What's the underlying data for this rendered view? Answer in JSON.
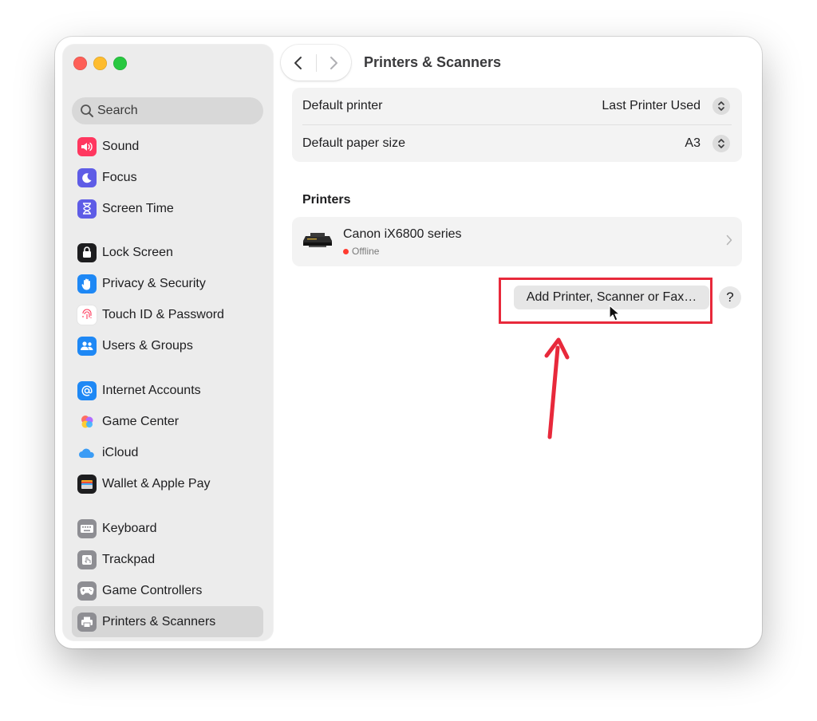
{
  "sidebar": {
    "search": {
      "placeholder": "Search"
    },
    "items": [
      {
        "label": "Sound",
        "icon": "speaker-icon",
        "color": "#ff375f",
        "selected": false
      },
      {
        "label": "Focus",
        "icon": "moon-icon",
        "color": "#5e5ce6",
        "selected": false
      },
      {
        "label": "Screen Time",
        "icon": "hourglass-icon",
        "color": "#5e5ce6",
        "selected": false
      },
      {
        "label": "Lock Screen",
        "icon": "lock-icon",
        "color": "#1d1d1f",
        "selected": false
      },
      {
        "label": "Privacy & Security",
        "icon": "hand-icon",
        "color": "#1e88f5",
        "selected": false
      },
      {
        "label": "Touch ID & Password",
        "icon": "fingerprint-icon",
        "color": "#ff3b5c",
        "selected": false
      },
      {
        "label": "Users & Groups",
        "icon": "users-icon",
        "color": "#1e88f5",
        "selected": false
      },
      {
        "label": "Internet Accounts",
        "icon": "at-icon",
        "color": "#1e88f5",
        "selected": false
      },
      {
        "label": "Game Center",
        "icon": "game-center-icon",
        "color": "#ff6f61",
        "selected": false
      },
      {
        "label": "iCloud",
        "icon": "cloud-icon",
        "color": "#3b9cf5",
        "selected": false
      },
      {
        "label": "Wallet & Apple Pay",
        "icon": "wallet-icon",
        "color": "#1d1d1f",
        "selected": false
      },
      {
        "label": "Keyboard",
        "icon": "keyboard-icon",
        "color": "#8e8e93",
        "selected": false
      },
      {
        "label": "Trackpad",
        "icon": "trackpad-icon",
        "color": "#8e8e93",
        "selected": false
      },
      {
        "label": "Game Controllers",
        "icon": "gamepad-icon",
        "color": "#8e8e93",
        "selected": false
      },
      {
        "label": "Printers & Scanners",
        "icon": "printer-icon",
        "color": "#8e8e93",
        "selected": true
      }
    ]
  },
  "header": {
    "title": "Printers & Scanners"
  },
  "settings": {
    "default_printer": {
      "label": "Default printer",
      "value": "Last Printer Used"
    },
    "default_paper": {
      "label": "Default paper size",
      "value": "A3"
    }
  },
  "printers": {
    "section_title": "Printers",
    "items": [
      {
        "name": "Canon iX6800 series",
        "status": "Offline",
        "status_color": "#ff3b30"
      }
    ]
  },
  "actions": {
    "add_label": "Add Printer, Scanner or Fax…",
    "help_label": "?"
  },
  "annotation": {
    "color": "#e8293b"
  }
}
